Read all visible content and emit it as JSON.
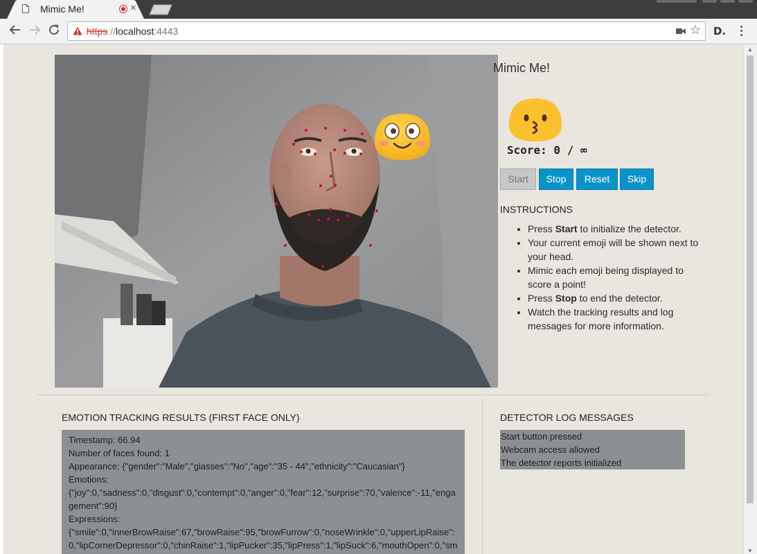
{
  "browser": {
    "tab_title": "Mimic Me!",
    "tab_close": "×",
    "url_protocol": "https",
    "url_separator": "://",
    "url_host": "localhost",
    "url_port": ":4443",
    "extension_label": "D."
  },
  "page": {
    "title": "Mimic Me!",
    "score_text": "Score: 0 / ∞",
    "buttons": {
      "start": "Start",
      "stop": "Stop",
      "reset": "Reset",
      "skip": "Skip"
    },
    "instructions_heading": "INSTRUCTIONS",
    "instructions": [
      [
        "Press ",
        "Start",
        " to initialize the detector."
      ],
      [
        "Your current emoji will be shown next to your head.",
        "",
        ""
      ],
      [
        "Mimic each emoji being displayed to score a point!",
        "",
        ""
      ],
      [
        "Press ",
        "Stop",
        " to end the detector."
      ],
      [
        "Watch the tracking results and log messages for more information.",
        "",
        ""
      ]
    ],
    "results_heading": "EMOTION TRACKING RESULTS (FIRST FACE ONLY)",
    "results_lines": [
      "Timestamp: 66.94",
      "Number of faces found: 1",
      "Appearance: {\"gender\":\"Male\",\"glasses\":\"No\",\"age\":\"35 - 44\",\"ethnicity\":\"Caucasian\"}",
      "Emotions:",
      "{\"joy\":0,\"sadness\":0,\"disgust\":0,\"contempt\":0,\"anger\":0,\"fear\":12,\"surprise\":70,\"valence\":-11,\"engagement\":90}",
      "Expressions:",
      "{\"smile\":0,\"innerBrowRaise\":67,\"browRaise\":95,\"browFurrow\":0,\"noseWrinkle\":0,\"upperLipRaise\":0,\"lipCornerDepressor\":0,\"chinRaise\":1,\"lipPucker\":35,\"lipPress\":1,\"lipSuck\":6,\"mouthOpen\":0,\"sm"
    ],
    "log_heading": "DETECTOR LOG MESSAGES",
    "log_lines": [
      "Start button pressed",
      "Webcam access allowed",
      "The detector reports initialized"
    ]
  },
  "colors": {
    "button_blue": "#0a93c9",
    "panel_gray": "#8d9093",
    "page_bg": "#e9e5df",
    "emoji_yellow": "#fbc02d",
    "landmark_red": "#c8102e"
  },
  "icons": {
    "target_emoji": "kissing-face-emoji",
    "detected_emoji": "flushed-smiling-face-emoji"
  }
}
